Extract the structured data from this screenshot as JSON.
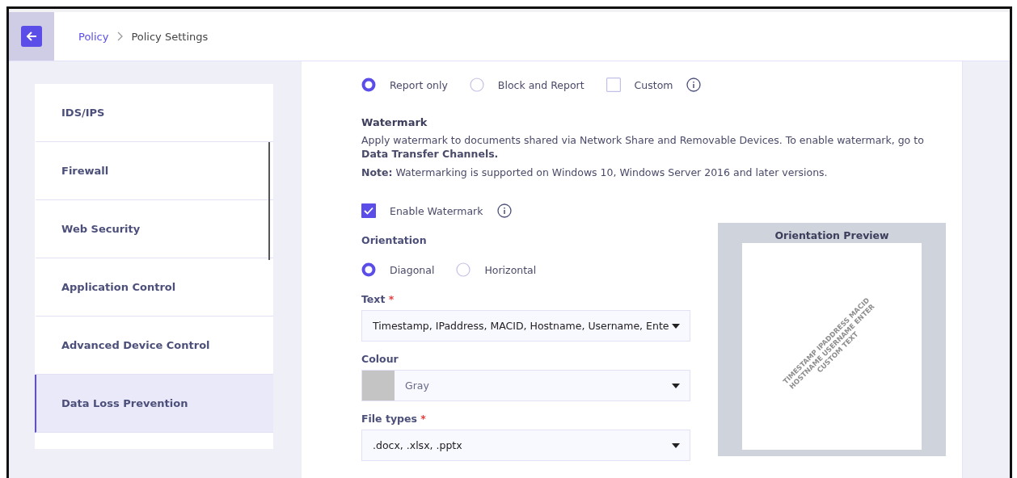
{
  "breadcrumb": [
    {
      "label": "Policy",
      "kind": "link"
    },
    {
      "label": "Policy Settings",
      "kind": "current"
    }
  ],
  "sidebar": {
    "items": [
      {
        "label": "IDS/IPS",
        "selected": false
      },
      {
        "label": "Firewall",
        "selected": false
      },
      {
        "label": "Web Security",
        "selected": false
      },
      {
        "label": "Application Control",
        "selected": false
      },
      {
        "label": "Advanced Device Control",
        "selected": false
      },
      {
        "label": "Data Loss Prevention",
        "selected": true
      }
    ]
  },
  "action_options": [
    {
      "kind": "radio",
      "label": "Report only",
      "selected": true,
      "info": false
    },
    {
      "kind": "radio",
      "label": "Block and Report",
      "selected": false,
      "info": false
    },
    {
      "kind": "checkbox",
      "label": "Custom",
      "checked": false,
      "info": true
    }
  ],
  "watermark": {
    "title": "Watermark",
    "description": "Apply watermark to documents shared via Network Share and Removable Devices. To enable watermark, go to **Data Transfer Channels.**",
    "note": "**Note:** Watermarking is supported on Windows 10, Windows Server 2016 and later versions.",
    "enable": {
      "label": "Enable Watermark",
      "checked": true
    },
    "orientation": {
      "label": "Orientation",
      "options": [
        {
          "label": "Diagonal",
          "selected": true
        },
        {
          "label": "Horizontal",
          "selected": false
        }
      ]
    },
    "text": {
      "label": "Text",
      "required_mark": "*",
      "value": "Timestamp, IPaddress, MACID, Hostname, Username, Ente"
    },
    "colour": {
      "label": "Colour",
      "value": "Gray",
      "color": "#c4c4c4"
    },
    "file_types": {
      "label": "File types",
      "required_mark": "*",
      "value": ".docx, .xlsx, .pptx"
    },
    "preview": {
      "title": "Orientation Preview",
      "lines": [
        "TIMESTAMP IPADDRESS MACID",
        "HOSTNAME USERNAME ENTER",
        "CUSTOM TEXT"
      ]
    }
  }
}
